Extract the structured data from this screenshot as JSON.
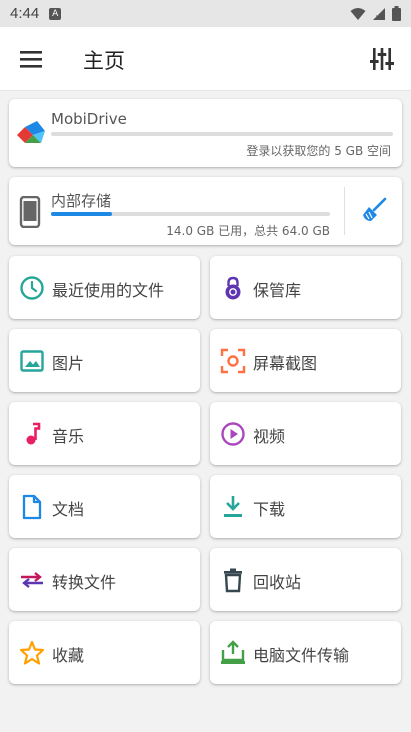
{
  "status_bar": {
    "time": "4:44"
  },
  "app_bar": {
    "title": "主页"
  },
  "mobidrive": {
    "name": "MobiDrive",
    "subtitle": "登录以获取您的 5 GB 空间",
    "progress": 0
  },
  "storage": {
    "name": "内部存储",
    "usage_text": "14.0 GB 已用，总共 64.0 GB",
    "used_fraction": 0.219
  },
  "tiles": [
    {
      "label": "最近使用的文件",
      "icon": "clock-icon"
    },
    {
      "label": "保管库",
      "icon": "lock-icon"
    },
    {
      "label": "图片",
      "icon": "image-icon"
    },
    {
      "label": "屏幕截图",
      "icon": "screenshot-icon"
    },
    {
      "label": "音乐",
      "icon": "music-note-icon"
    },
    {
      "label": "视频",
      "icon": "play-circle-icon"
    },
    {
      "label": "文档",
      "icon": "document-icon"
    },
    {
      "label": "下载",
      "icon": "download-icon"
    },
    {
      "label": "转换文件",
      "icon": "convert-icon"
    },
    {
      "label": "回收站",
      "icon": "trash-icon"
    },
    {
      "label": "收藏",
      "icon": "star-icon"
    },
    {
      "label": "电脑文件传输",
      "icon": "pc-transfer-icon"
    }
  ],
  "colors": {
    "accent": "#1e88e5",
    "teal": "#26a69a",
    "purple": "#5e35b1",
    "pink": "#e91e63",
    "orange": "#ff7043",
    "green": "#43a047",
    "amber": "#ffa000"
  }
}
